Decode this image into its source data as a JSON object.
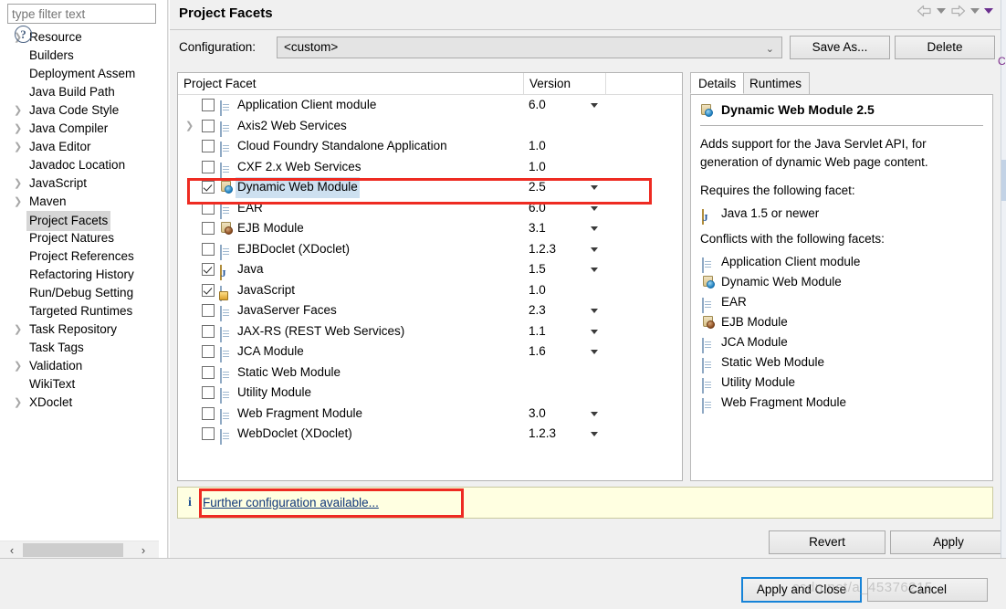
{
  "sidebar": {
    "filter_placeholder": "type filter text",
    "items": [
      {
        "label": "Resource",
        "expandable": true,
        "selected": false
      },
      {
        "label": "Builders",
        "expandable": false,
        "selected": false
      },
      {
        "label": "Deployment Assem",
        "expandable": false,
        "selected": false
      },
      {
        "label": "Java Build Path",
        "expandable": false,
        "selected": false
      },
      {
        "label": "Java Code Style",
        "expandable": true,
        "selected": false
      },
      {
        "label": "Java Compiler",
        "expandable": true,
        "selected": false
      },
      {
        "label": "Java Editor",
        "expandable": true,
        "selected": false
      },
      {
        "label": "Javadoc Location",
        "expandable": false,
        "selected": false
      },
      {
        "label": "JavaScript",
        "expandable": true,
        "selected": false
      },
      {
        "label": "Maven",
        "expandable": true,
        "selected": false
      },
      {
        "label": "Project Facets",
        "expandable": false,
        "selected": true
      },
      {
        "label": "Project Natures",
        "expandable": false,
        "selected": false
      },
      {
        "label": "Project References",
        "expandable": false,
        "selected": false
      },
      {
        "label": "Refactoring History",
        "expandable": false,
        "selected": false
      },
      {
        "label": "Run/Debug Setting",
        "expandable": false,
        "selected": false
      },
      {
        "label": "Targeted Runtimes",
        "expandable": false,
        "selected": false
      },
      {
        "label": "Task Repository",
        "expandable": true,
        "selected": false
      },
      {
        "label": "Task Tags",
        "expandable": false,
        "selected": false
      },
      {
        "label": "Validation",
        "expandable": true,
        "selected": false
      },
      {
        "label": "WikiText",
        "expandable": false,
        "selected": false
      },
      {
        "label": "XDoclet",
        "expandable": true,
        "selected": false
      }
    ]
  },
  "header": {
    "title": "Project Facets",
    "nav": {
      "back_icon": "back-arrow-icon",
      "back_menu_icon": "chevron-down-icon",
      "forward_icon": "forward-arrow-icon",
      "forward_menu_icon": "chevron-down-icon",
      "view_menu_icon": "chevron-down-icon"
    }
  },
  "configuration": {
    "label": "Configuration:",
    "value": "<custom>",
    "chevron": "⌄",
    "save_as_label": "Save As...",
    "delete_label": "Delete"
  },
  "facet_table": {
    "columns": [
      "Project Facet",
      "Version",
      ""
    ],
    "rows": [
      {
        "name": "Application Client module",
        "version": "6.0",
        "checked": false,
        "icon": "document-icon",
        "has_version_menu": true,
        "expandable": false,
        "selected": false
      },
      {
        "name": "Axis2 Web Services",
        "version": "",
        "checked": false,
        "icon": "document-icon",
        "has_version_menu": false,
        "expandable": true,
        "selected": false
      },
      {
        "name": "Cloud Foundry Standalone Application",
        "version": "1.0",
        "checked": false,
        "icon": "document-icon",
        "has_version_menu": false,
        "expandable": false,
        "selected": false
      },
      {
        "name": "CXF 2.x Web Services",
        "version": "1.0",
        "checked": false,
        "icon": "document-icon",
        "has_version_menu": false,
        "expandable": false,
        "selected": false
      },
      {
        "name": "Dynamic Web Module",
        "version": "2.5",
        "checked": true,
        "icon": "web-module-icon",
        "has_version_menu": true,
        "expandable": false,
        "selected": true
      },
      {
        "name": "EAR",
        "version": "6.0",
        "checked": false,
        "icon": "document-icon",
        "has_version_menu": true,
        "expandable": false,
        "selected": false
      },
      {
        "name": "EJB Module",
        "version": "3.1",
        "checked": false,
        "icon": "ejb-module-icon",
        "has_version_menu": true,
        "expandable": false,
        "selected": false
      },
      {
        "name": "EJBDoclet (XDoclet)",
        "version": "1.2.3",
        "checked": false,
        "icon": "document-icon",
        "has_version_menu": true,
        "expandable": false,
        "selected": false
      },
      {
        "name": "Java",
        "version": "1.5",
        "checked": true,
        "icon": "java-icon",
        "has_version_menu": true,
        "expandable": false,
        "selected": false
      },
      {
        "name": "JavaScript",
        "version": "1.0",
        "checked": true,
        "icon": "javascript-icon",
        "has_version_menu": false,
        "expandable": false,
        "selected": false
      },
      {
        "name": "JavaServer Faces",
        "version": "2.3",
        "checked": false,
        "icon": "document-icon",
        "has_version_menu": true,
        "expandable": false,
        "selected": false
      },
      {
        "name": "JAX-RS (REST Web Services)",
        "version": "1.1",
        "checked": false,
        "icon": "document-icon",
        "has_version_menu": true,
        "expandable": false,
        "selected": false
      },
      {
        "name": "JCA Module",
        "version": "1.6",
        "checked": false,
        "icon": "document-icon",
        "has_version_menu": true,
        "expandable": false,
        "selected": false
      },
      {
        "name": "Static Web Module",
        "version": "",
        "checked": false,
        "icon": "document-icon",
        "has_version_menu": false,
        "expandable": false,
        "selected": false
      },
      {
        "name": "Utility Module",
        "version": "",
        "checked": false,
        "icon": "document-icon",
        "has_version_menu": false,
        "expandable": false,
        "selected": false
      },
      {
        "name": "Web Fragment Module",
        "version": "3.0",
        "checked": false,
        "icon": "document-icon",
        "has_version_menu": true,
        "expandable": false,
        "selected": false
      },
      {
        "name": "WebDoclet (XDoclet)",
        "version": "1.2.3",
        "checked": false,
        "icon": "document-icon",
        "has_version_menu": true,
        "expandable": false,
        "selected": false
      }
    ]
  },
  "details": {
    "tabs": [
      {
        "label": "Details",
        "active": true
      },
      {
        "label": "Runtimes",
        "active": false
      }
    ],
    "facet_title": "Dynamic Web Module 2.5",
    "facet_icon": "web-module-icon",
    "description": "Adds support for the Java Servlet API, for generation of dynamic Web page content.",
    "requires_label": "Requires the following facet:",
    "requires": [
      {
        "label": "Java 1.5 or newer",
        "icon": "java-icon"
      }
    ],
    "conflicts_label": "Conflicts with the following facets:",
    "conflicts": [
      {
        "label": "Application Client module",
        "icon": "document-icon"
      },
      {
        "label": "Dynamic Web Module",
        "icon": "web-module-icon"
      },
      {
        "label": "EAR",
        "icon": "document-icon"
      },
      {
        "label": "EJB Module",
        "icon": "ejb-module-icon"
      },
      {
        "label": "JCA Module",
        "icon": "document-icon"
      },
      {
        "label": "Static Web Module",
        "icon": "document-icon"
      },
      {
        "label": "Utility Module",
        "icon": "document-icon"
      },
      {
        "label": "Web Fragment Module",
        "icon": "document-icon"
      }
    ]
  },
  "info_bar": {
    "icon": "info-icon",
    "icon_glyph": "i",
    "link_text": "Further configuration available..."
  },
  "buttons": {
    "revert": "Revert",
    "apply": "Apply",
    "apply_and_close": "Apply and Close",
    "cancel": "Cancel",
    "help_icon_glyph": "?"
  },
  "scrollbars": {
    "left_prev_glyph": "‹",
    "left_next_glyph": "›"
  },
  "annotations": {
    "accent_color": "#ee2b22",
    "selected_row_highlight": "#cde0f0",
    "focus_border": "#1683d8",
    "info_bar_bg": "#ffffe1"
  },
  "watermark": {
    "text": "csdn.net/a_45376215"
  }
}
